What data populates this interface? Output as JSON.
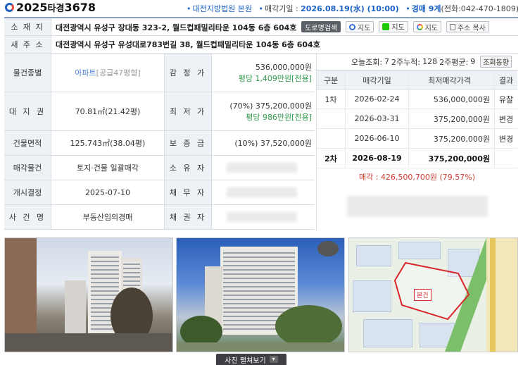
{
  "header": {
    "year": "2025",
    "type": "타경",
    "number": "3678",
    "court": "대전지방법원 본원",
    "auction_label": "매각기일 : ",
    "auction_date": "2026.08.19(水) (10:00)",
    "dept_label": "경매 9계",
    "phone": "(전화:042-470-1809)"
  },
  "address": {
    "lot_label": "소 재 지",
    "lot_value": "대전광역시 유성구 장대동 323-2, 월드컵패밀리타운 104동 6층 604호",
    "road_label": "새 주 소",
    "road_value": "대전광역시 유성구 유성대로783번길 38, 월드컵패밀리타운 104동 6층 604호",
    "buttons": {
      "road_search": "도로명검색",
      "daum_map": "지도",
      "naver_map": "지도",
      "google_map": "지도",
      "copy_address": "주소 복사"
    }
  },
  "details": {
    "type_label": "물건종별",
    "type_value": "아파트",
    "type_note": "[공급47평형]",
    "appraisal_label": "감 정 가",
    "appraisal_value": "536,000,000원",
    "appraisal_pyeong": "평당 1,409만원[전용]",
    "land_label": "대 지 권",
    "land_value": "70.81㎡(21.42평)",
    "minprice_label": "최 저 가",
    "minprice_value": "(70%) 375,200,000원",
    "minprice_pyeong": "평당 986만원[전용]",
    "building_label": "건물면적",
    "building_value": "125.743㎡(38.04평)",
    "deposit_label": "보 증 금",
    "deposit_value": "(10%) 37,520,000원",
    "sale_label": "매각물건",
    "sale_value": "토지·건물 일괄매각",
    "owner_label": "소 유 자",
    "start_label": "개시결정",
    "start_value": "2025-07-10",
    "debtor_label": "채 무 자",
    "case_label": "사 건 명",
    "case_value": "부동산임의경매",
    "creditor_label": "채 권 자"
  },
  "history": {
    "today_label": "오늘조회:",
    "today": "7",
    "twoweek_label": "2주누적:",
    "twoweek": "128",
    "twoweek_avg_label": "2주평균:",
    "twoweek_avg": "9",
    "trend_button": "조회동향",
    "columns": [
      "구분",
      "매각기일",
      "최저매각가격",
      "결과"
    ],
    "rows": [
      {
        "round": "1차",
        "date": "2026-02-24",
        "price": "536,000,000원",
        "result": "유찰"
      },
      {
        "round": "",
        "date": "2026-03-31",
        "price": "375,200,000원",
        "result": "변경"
      },
      {
        "round": "",
        "date": "2026-06-10",
        "price": "375,200,000원",
        "result": "변경"
      },
      {
        "round": "2차",
        "date": "2026-08-19",
        "price": "375,200,000원",
        "result": ""
      }
    ],
    "sold_text": "매각 : 426,500,700원",
    "sold_ratio": "(79.57%)"
  },
  "photos": {
    "view_all": "사진 펼쳐보기",
    "map_marker": "본건"
  }
}
